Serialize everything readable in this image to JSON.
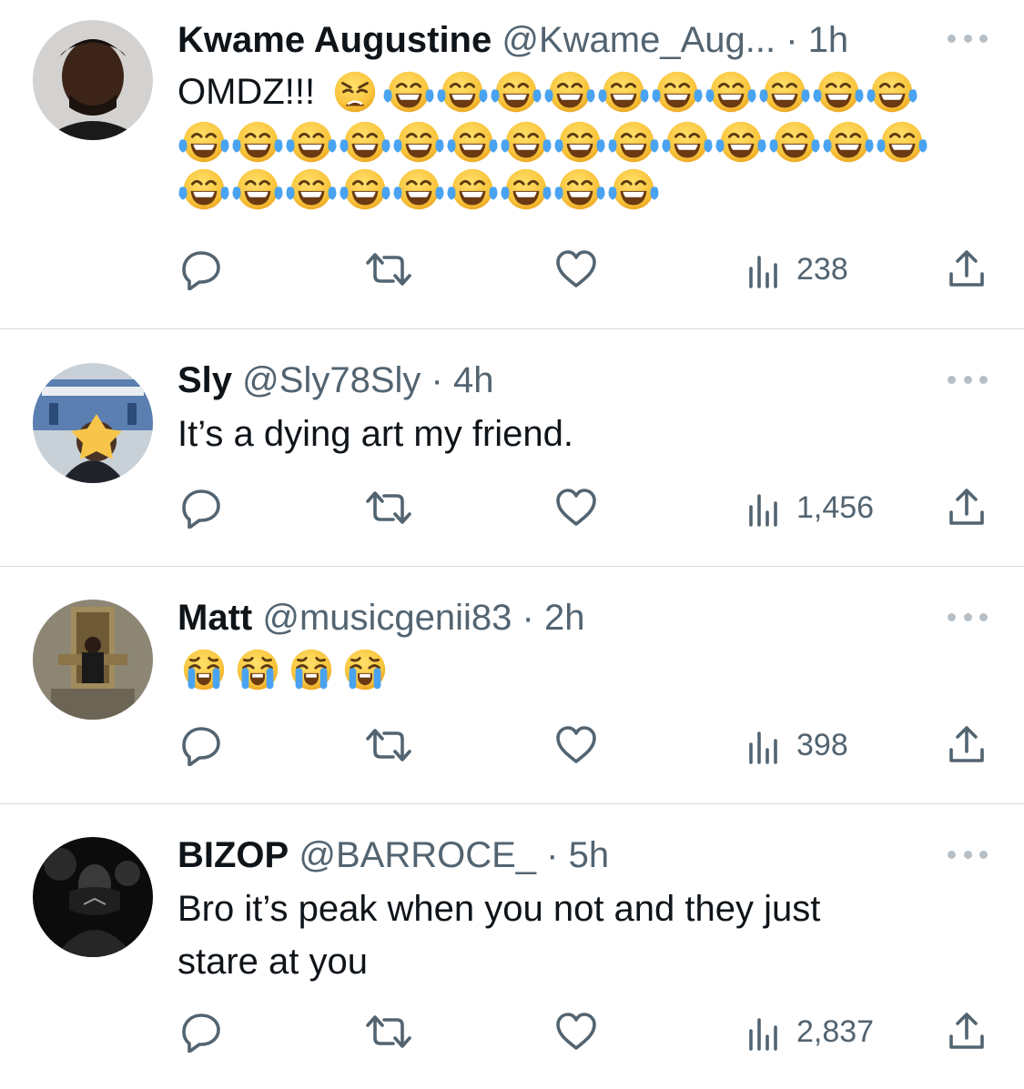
{
  "tweets": [
    {
      "name": "Kwame Augustine",
      "handle": "@Kwame_Aug...",
      "dot": "·",
      "time": "1h",
      "text_prefix": "OMDZ!!!",
      "emoji_summary": [
        "weary-face",
        "face-with-tears-of-joy x33"
      ],
      "views": "238"
    },
    {
      "name": "Sly",
      "handle": "@Sly78Sly",
      "dot": "·",
      "time": "4h",
      "text": "It’s a dying art my friend.",
      "views": "1,456"
    },
    {
      "name": "Matt",
      "handle": "@musicgenii83",
      "dot": "·",
      "time": "2h",
      "emoji_summary": [
        "loudly-crying-face x4"
      ],
      "views": "398"
    },
    {
      "name": "BIZOP",
      "handle": "@BARROCE_",
      "dot": "·",
      "time": "5h",
      "text_line1": "Bro it’s peak when you not and they just",
      "text_line2": "stare at you",
      "views": "2,837"
    }
  ],
  "icons": {
    "reply": "reply-icon",
    "retweet": "retweet-icon",
    "like": "like-icon",
    "views": "views-icon",
    "share": "share-icon",
    "more": "more-icon"
  },
  "colors": {
    "text": "#0f1419",
    "secondary": "#536471",
    "divider": "#d6dbdf",
    "emoji_yellow": "#f9c43c",
    "tear_blue": "#4aa3f0"
  }
}
